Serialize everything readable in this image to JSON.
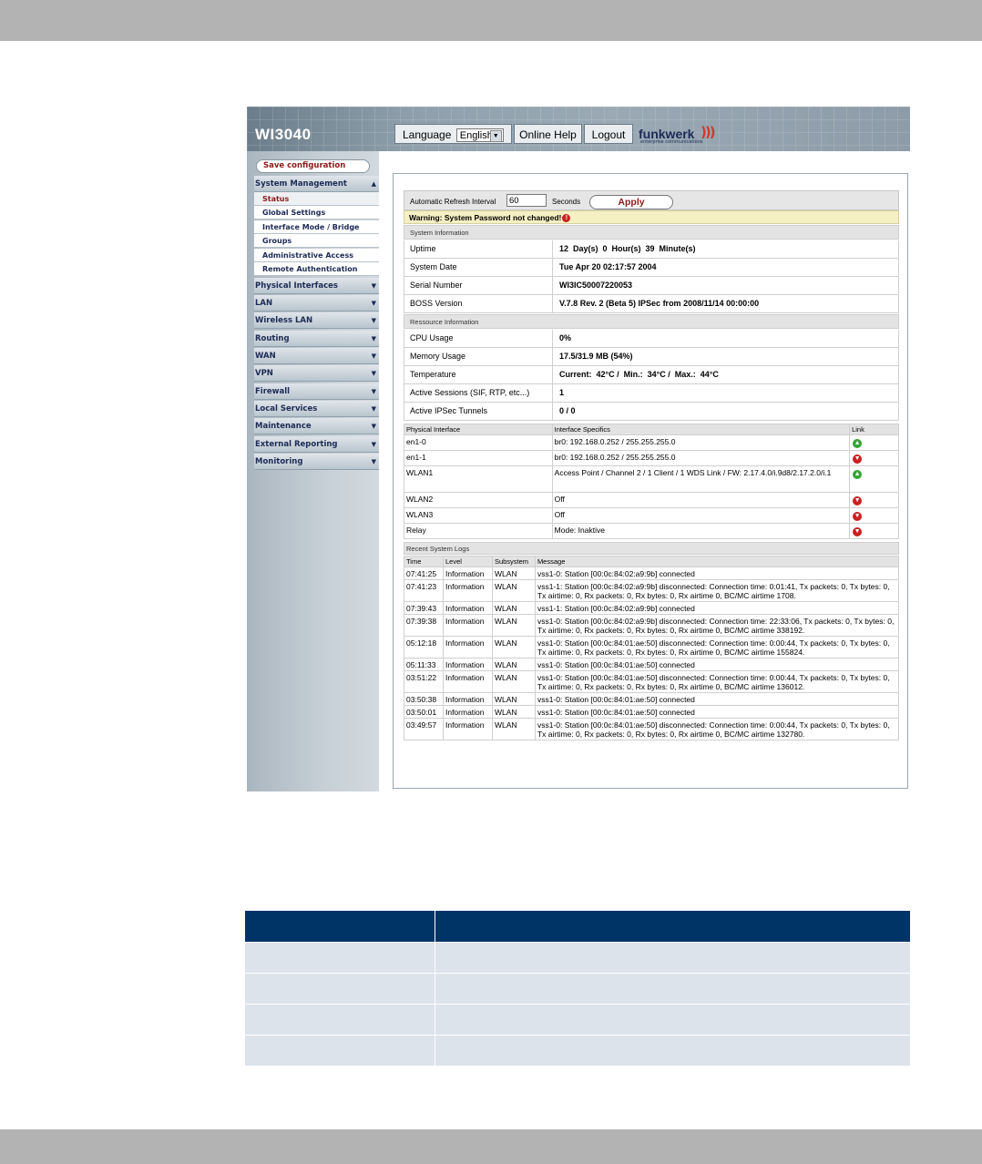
{
  "app": {
    "product_name": "WI3040",
    "header": {
      "language_label": "Language",
      "language_value": "English",
      "online_help": "Online Help",
      "logout": "Logout",
      "brand_word": "funkwerk",
      "brand_sub": "enterprise communications"
    },
    "sidebar": {
      "save_label": "Save configuration",
      "system_management": "System Management",
      "sub_items": [
        "Status",
        "Global Settings",
        "Interface Mode / Bridge",
        "Groups",
        "Administrative Access",
        "Remote Authentication"
      ],
      "items": [
        "Physical Interfaces",
        "LAN",
        "Wireless LAN",
        "Routing",
        "WAN",
        "VPN",
        "Firewall",
        "Local Services",
        "Maintenance",
        "External Reporting",
        "Monitoring"
      ]
    },
    "refresh": {
      "label": "Automatic Refresh Interval",
      "value": "60",
      "unit": "Seconds",
      "apply": "Apply"
    },
    "warning": "Warning: System Password not changed!",
    "system_info": {
      "title": "System Information",
      "rows": [
        {
          "k": "Uptime",
          "v": "12  Day(s)  0  Hour(s)  39  Minute(s)"
        },
        {
          "k": "System Date",
          "v": "Tue Apr 20 02:17:57 2004"
        },
        {
          "k": "Serial Number",
          "v": "WI3IC50007220053"
        },
        {
          "k": "BOSS Version",
          "v": "V.7.8 Rev. 2 (Beta 5) IPSec from 2008/11/14 00:00:00"
        }
      ]
    },
    "resource_info": {
      "title": "Ressource Information",
      "rows": [
        {
          "k": "CPU Usage",
          "v": "0%"
        },
        {
          "k": "Memory Usage",
          "v": "17.5/31.9 MB (54%)"
        },
        {
          "k": "Temperature",
          "v": "Current:  42°C /  Min.:  34°C /  Max.:  44°C"
        },
        {
          "k": "Active Sessions (SIF, RTP, etc...)",
          "v": "1"
        },
        {
          "k": "Active IPSec Tunnels",
          "v": "0 / 0"
        }
      ]
    },
    "interfaces": {
      "headers": [
        "Physical Interface",
        "Interface Specifics",
        "Link"
      ],
      "rows": [
        {
          "name": "en1-0",
          "spec": "br0:  192.168.0.252 / 255.255.255.0",
          "link": "up"
        },
        {
          "name": "en1-1",
          "spec": "br0:  192.168.0.252 / 255.255.255.0",
          "link": "down"
        },
        {
          "name": "WLAN1",
          "spec": "Access Point /  Channel   2 / 1    Client / 1   WDS Link / FW: 2.17.4.0/i.9d8/2.17.2.0/i.1",
          "link": "up"
        },
        {
          "name": "WLAN2",
          "spec": "Off",
          "link": "down"
        },
        {
          "name": "WLAN3",
          "spec": "Off",
          "link": "down"
        },
        {
          "name": "Relay",
          "spec": "Mode: Inaktive",
          "link": "down"
        }
      ]
    },
    "logs": {
      "title": "Recent System Logs",
      "headers": [
        "Time",
        "Level",
        "Subsystem",
        "Message"
      ],
      "rows": [
        {
          "time": "07:41:25",
          "level": "Information",
          "sub": "WLAN",
          "msg": "vss1-0: Station [00:0c:84:02:a9:9b] connected"
        },
        {
          "time": "07:41:23",
          "level": "Information",
          "sub": "WLAN",
          "msg": "vss1-1: Station [00:0c:84:02:a9:9b] disconnected: Connection time: 0:01:41, Tx packets: 0, Tx bytes: 0, Tx airtime: 0, Rx packets: 0, Rx bytes: 0, Rx airtime 0, BC/MC airtime 1708."
        },
        {
          "time": "07:39:43",
          "level": "Information",
          "sub": "WLAN",
          "msg": "vss1-1: Station [00:0c:84:02:a9:9b] connected"
        },
        {
          "time": "07:39:38",
          "level": "Information",
          "sub": "WLAN",
          "msg": "vss1-0: Station [00:0c:84:02:a9:9b] disconnected: Connection time: 22:33:06, Tx packets: 0, Tx bytes: 0, Tx airtime: 0, Rx packets: 0, Rx bytes: 0, Rx airtime 0, BC/MC airtime 338192."
        },
        {
          "time": "05:12:18",
          "level": "Information",
          "sub": "WLAN",
          "msg": "vss1-0: Station [00:0c:84:01:ae:50] disconnected: Connection time: 0:00:44, Tx packets: 0, Tx bytes: 0, Tx airtime: 0, Rx packets: 0, Rx bytes: 0, Rx airtime 0, BC/MC airtime 155824."
        },
        {
          "time": "05:11:33",
          "level": "Information",
          "sub": "WLAN",
          "msg": "vss1-0: Station [00:0c:84:01:ae:50] connected"
        },
        {
          "time": "03:51:22",
          "level": "Information",
          "sub": "WLAN",
          "msg": "vss1-0: Station [00:0c:84:01:ae:50] disconnected: Connection time: 0:00:44, Tx packets: 0, Tx bytes: 0, Tx airtime: 0, Rx packets: 0, Rx bytes: 0, Rx airtime 0, BC/MC airtime 136012."
        },
        {
          "time": "03:50:38",
          "level": "Information",
          "sub": "WLAN",
          "msg": "vss1-0: Station [00:0c:84:01:ae:50] connected"
        },
        {
          "time": "03:50:01",
          "level": "Information",
          "sub": "WLAN",
          "msg": "vss1-0: Station [00:0c:84:01:ae:50] connected"
        },
        {
          "time": "03:49:57",
          "level": "Information",
          "sub": "WLAN",
          "msg": "vss1-0: Station [00:0c:84:01:ae:50] disconnected: Connection time: 0:00:44, Tx packets: 0, Tx bytes: 0, Tx airtime: 0, Rx packets: 0, Rx bytes: 0, Rx airtime 0, BC/MC airtime 132780."
        }
      ]
    }
  },
  "colors": {
    "gray_bar": "#b3b3b3",
    "table_header": "#003366",
    "table_row": "#dde3ea",
    "link_up": "#35a534",
    "link_down": "#cc1f1f",
    "warning_bg": "#f5f0c4"
  }
}
